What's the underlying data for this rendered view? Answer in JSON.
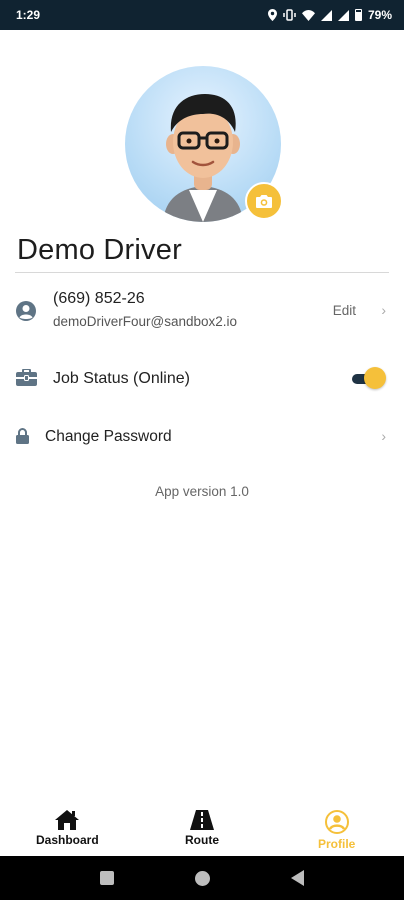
{
  "status_bar": {
    "time": "1:29",
    "battery": "79%"
  },
  "profile": {
    "name": "Demo Driver",
    "phone": "(669) 852-26",
    "email": "demoDriverFour@sandbox2.io",
    "edit_label": "Edit"
  },
  "settings": {
    "job_status_label": "Job Status (Online)",
    "job_status_on": true,
    "change_password_label": "Change Password"
  },
  "app_version": "App version 1.0",
  "bottom_nav": {
    "items": [
      {
        "label": "Dashboard",
        "icon": "home-icon"
      },
      {
        "label": "Route",
        "icon": "road-icon"
      },
      {
        "label": "Profile",
        "icon": "profile-icon"
      }
    ],
    "active_index": 2
  },
  "colors": {
    "accent": "#f5c03a",
    "status_bar": "#102331",
    "toggle_track": "#1f3344"
  }
}
